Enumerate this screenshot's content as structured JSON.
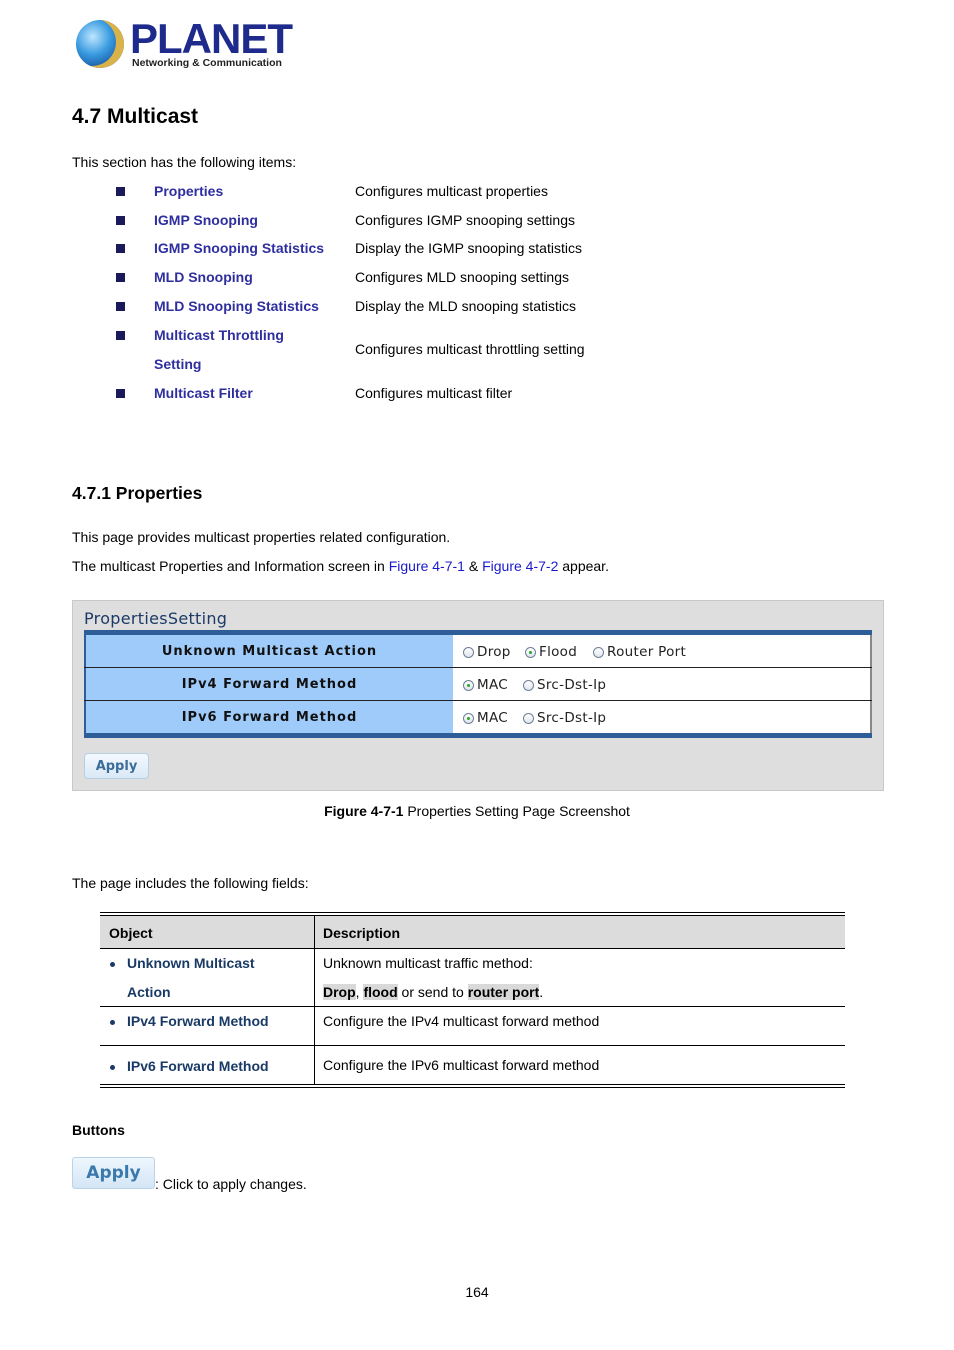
{
  "logo": {
    "brand": "PLANET",
    "tagline": "Networking & Communication"
  },
  "section": {
    "title": "4.7 Multicast",
    "intro": "This section has the following items:",
    "items": [
      {
        "name": "Properties",
        "description": "Configures multicast properties"
      },
      {
        "name": "IGMP Snooping",
        "description": "Configures IGMP snooping settings"
      },
      {
        "name": "IGMP Snooping Statistics",
        "description": "Display the IGMP snooping statistics"
      },
      {
        "name": "MLD Snooping",
        "description": "Configures MLD snooping settings"
      },
      {
        "name": "MLD Snooping Statistics",
        "description": "Display the MLD snooping statistics"
      },
      {
        "name_line1": "Multicast Throttling",
        "name_line2": "Setting",
        "description": "Configures multicast throttling setting"
      },
      {
        "name": "Multicast Filter",
        "description": "Configures multicast filter"
      }
    ]
  },
  "subsection": {
    "title": "4.7.1 Properties",
    "para1": "This page provides multicast properties related configuration.",
    "para2_prefix": "The multicast Properties and Information screen in ",
    "para2_link1": "Figure 4-7-1",
    "para2_mid": " & ",
    "para2_link2": "Figure 4-7-2",
    "para2_suffix": " appear."
  },
  "screenshot": {
    "title": "PropertiesSetting",
    "rows": [
      {
        "label": "Unknown Multicast Action",
        "options": [
          "Drop",
          "Flood",
          "Router Port"
        ],
        "selected": "Flood"
      },
      {
        "label": "IPv4 Forward Method",
        "options": [
          "MAC",
          "Src-Dst-Ip"
        ],
        "selected": "MAC"
      },
      {
        "label": "IPv6 Forward Method",
        "options": [
          "MAC",
          "Src-Dst-Ip"
        ],
        "selected": "MAC"
      }
    ],
    "apply_label": "Apply"
  },
  "caption": {
    "bold": "Figure 4-7-1",
    "text": " Properties Setting Page Screenshot"
  },
  "fields_intro": "The page includes the following fields:",
  "fields_table": {
    "headers": [
      "Object",
      "Description"
    ],
    "rows": [
      {
        "object_line1": "Unknown Multicast",
        "object_line2": "Action",
        "desc_line1": "Unknown multicast traffic method:",
        "desc_parts": {
          "a": "Drop",
          "b": ", ",
          "c": "flood",
          "d": " or send to ",
          "e": "router port",
          "f": "."
        }
      },
      {
        "object": "IPv4 Forward Method",
        "description": "Configure the IPv4 multicast forward method"
      },
      {
        "object": "IPv6 Forward Method",
        "description": "Configure the IPv6 multicast forward method"
      }
    ]
  },
  "buttons": {
    "heading": "Buttons",
    "apply_label": "Apply",
    "apply_desc": ": Click to apply changes."
  },
  "page_number": "164"
}
